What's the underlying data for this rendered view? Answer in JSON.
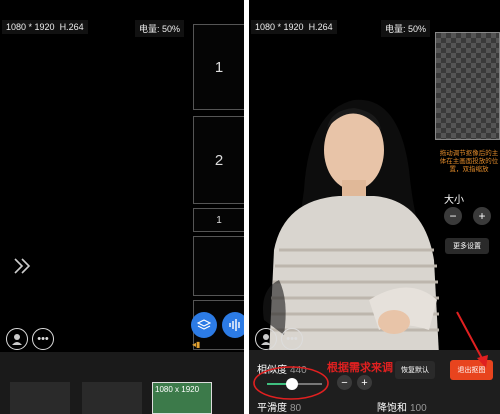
{
  "left": {
    "resolution": "1080 * 1920",
    "codec": "H.264",
    "battery": "电量: 50%",
    "slots": [
      "1",
      "2",
      "1"
    ],
    "thumb_text": "1080 x 1920",
    "icons": [
      "chevron-double-right-icon",
      "avatar-icon",
      "more-icon",
      "layers-icon",
      "audio-wave-icon"
    ]
  },
  "right": {
    "resolution": "1080 * 1920",
    "codec": "H.264",
    "battery": "电量: 50%",
    "hint": "拖动调节抠像后的主体在主画面投放的位置，双指缩放",
    "size_label": "大小",
    "minus": "−",
    "plus": "+",
    "more_settings": "更多设置",
    "similarity": {
      "label": "相似度",
      "value": "440"
    },
    "annotation": "根据需求来调",
    "restore_default": "恢复默认",
    "exit_matting": "退出抠图",
    "smoothness": {
      "label": "平滑度",
      "value": "80"
    },
    "desaturation": {
      "label": "降饱和",
      "value": "100"
    },
    "slider_value": 0.45,
    "accent_color": "#e8441e",
    "annotation_color": "#e02020"
  }
}
